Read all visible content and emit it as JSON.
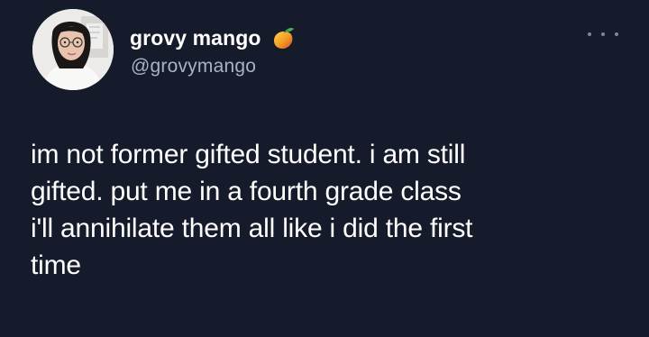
{
  "author": {
    "display_name": "grovy mango",
    "handle": "@grovymango",
    "badge_icon": "mango-emoji-icon",
    "avatar": "profile-photo"
  },
  "menu": {
    "icon": "more-options-icon"
  },
  "tweet": {
    "lines": [
      "im not former gifted student. i am still",
      "gifted. put me in a fourth grade class",
      "i'll annihilate them all like i did the first",
      "time"
    ]
  },
  "colors": {
    "background": "#161b2b",
    "text": "#ffffff",
    "handle": "#a6b4c2"
  }
}
